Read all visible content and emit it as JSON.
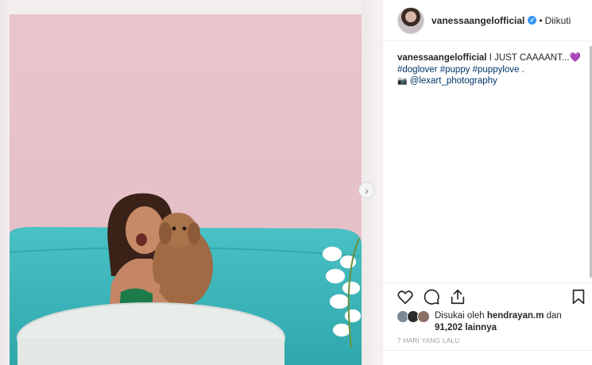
{
  "post": {
    "username": "vanessaangelofficial",
    "verified_mark": "✓",
    "separator": "•",
    "follow_status": "Diikuti",
    "caption_author": "vanessaangelofficial",
    "caption_text": " I JUST CAAAANT...",
    "caption_emoji": "💜",
    "hashtags": "#doglover #puppy #puppylove",
    "hashtags_suffix": " .",
    "camera_emoji": "📷",
    "credit": "@lexart_photography",
    "likes_prefix": "Disukai oleh ",
    "likes_user": "hendrayan.m",
    "likes_mid": " dan",
    "likes_count": "91,202 lainnya",
    "timestamp": "7 HARI YANG LALU"
  },
  "icons": {
    "like": "heart-icon",
    "comment": "comment-icon",
    "share": "share-icon",
    "save": "bookmark-icon",
    "next": "chevron-right-icon"
  },
  "next_glyph": "›",
  "colors": {
    "link": "#003569",
    "verified": "#3897f0",
    "timestamp": "#999999",
    "photo_wall": "#e7c4ca",
    "sofa": "#3fb8bd"
  }
}
